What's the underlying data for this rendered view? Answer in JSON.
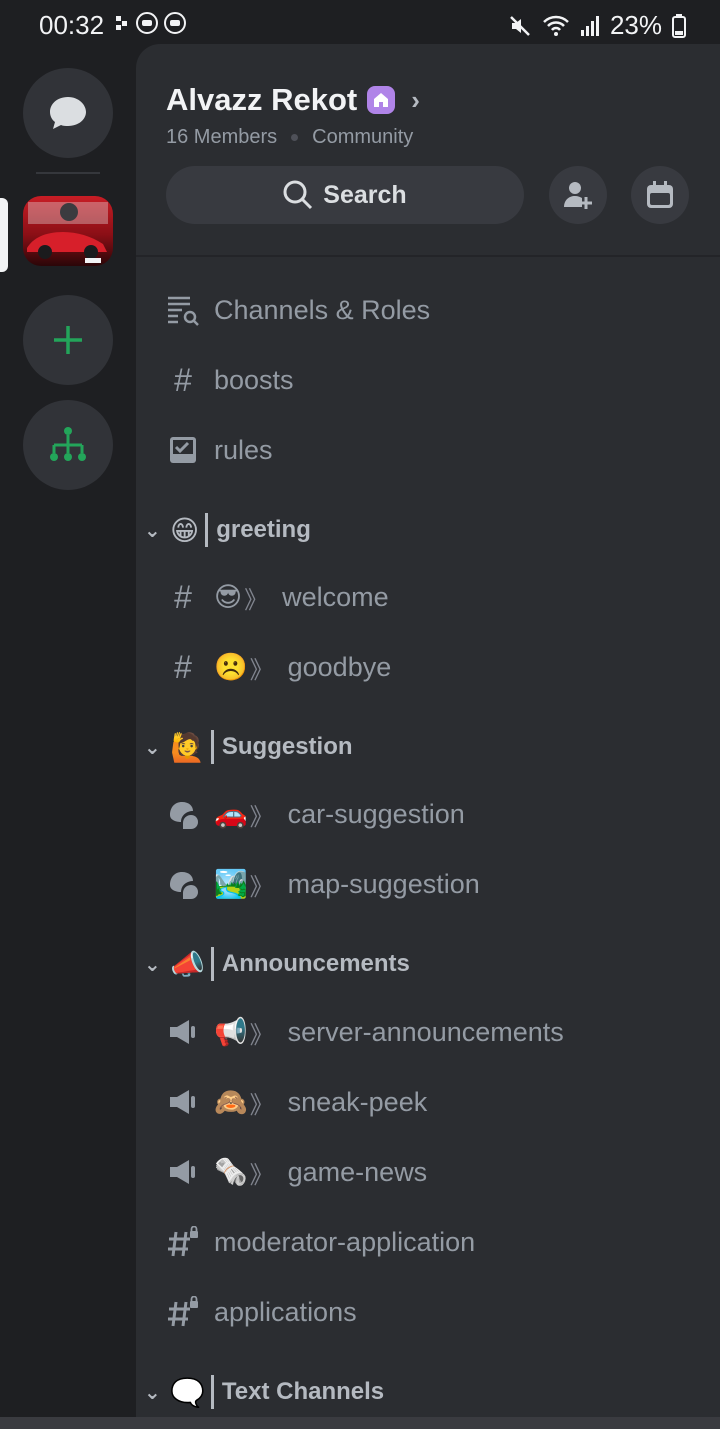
{
  "status_bar": {
    "time": "00:32",
    "battery": "23%"
  },
  "server": {
    "name": "Alvazz Rekot",
    "members": "16 Members",
    "type": "Community"
  },
  "search": {
    "label": "Search"
  },
  "top_channels": [
    {
      "icon": "channels-roles-icon",
      "label": "Channels & Roles"
    },
    {
      "icon": "hash-icon",
      "label": "boosts"
    },
    {
      "icon": "rules-icon",
      "label": "rules"
    }
  ],
  "categories": [
    {
      "emoji": "😁",
      "name": "greeting",
      "channels": [
        {
          "icon": "hash-icon",
          "emoji": "😎",
          "sep": "》",
          "name": "welcome"
        },
        {
          "icon": "hash-icon",
          "emoji": "☹️",
          "sep": "》",
          "name": "goodbye"
        }
      ]
    },
    {
      "emoji": "🙋",
      "name": "Suggestion",
      "channels": [
        {
          "icon": "forum-icon",
          "emoji": "🚗",
          "sep": "》",
          "name": "car-suggestion"
        },
        {
          "icon": "forum-icon",
          "emoji": "🏞️",
          "sep": "》",
          "name": "map-suggestion"
        }
      ]
    },
    {
      "emoji": "📣",
      "name": "Announcements",
      "channels": [
        {
          "icon": "announcement-icon",
          "emoji": "📢",
          "sep": "》",
          "name": "server-announcements"
        },
        {
          "icon": "announcement-icon",
          "emoji": "🙈",
          "sep": "》",
          "name": "sneak-peek"
        },
        {
          "icon": "announcement-icon",
          "emoji": "🗞️",
          "sep": "》",
          "name": "game-news"
        },
        {
          "icon": "locked-hash-icon",
          "emoji": "",
          "sep": "",
          "name": "moderator-application"
        },
        {
          "icon": "locked-hash-icon",
          "emoji": "",
          "sep": "",
          "name": "applications"
        }
      ]
    },
    {
      "emoji": "🗨️",
      "name": "Text Channels",
      "channels": []
    }
  ],
  "colors": {
    "background": "#1e1f22",
    "panel": "#2b2d31",
    "green": "#23a55a",
    "boost": "#b084e8"
  }
}
